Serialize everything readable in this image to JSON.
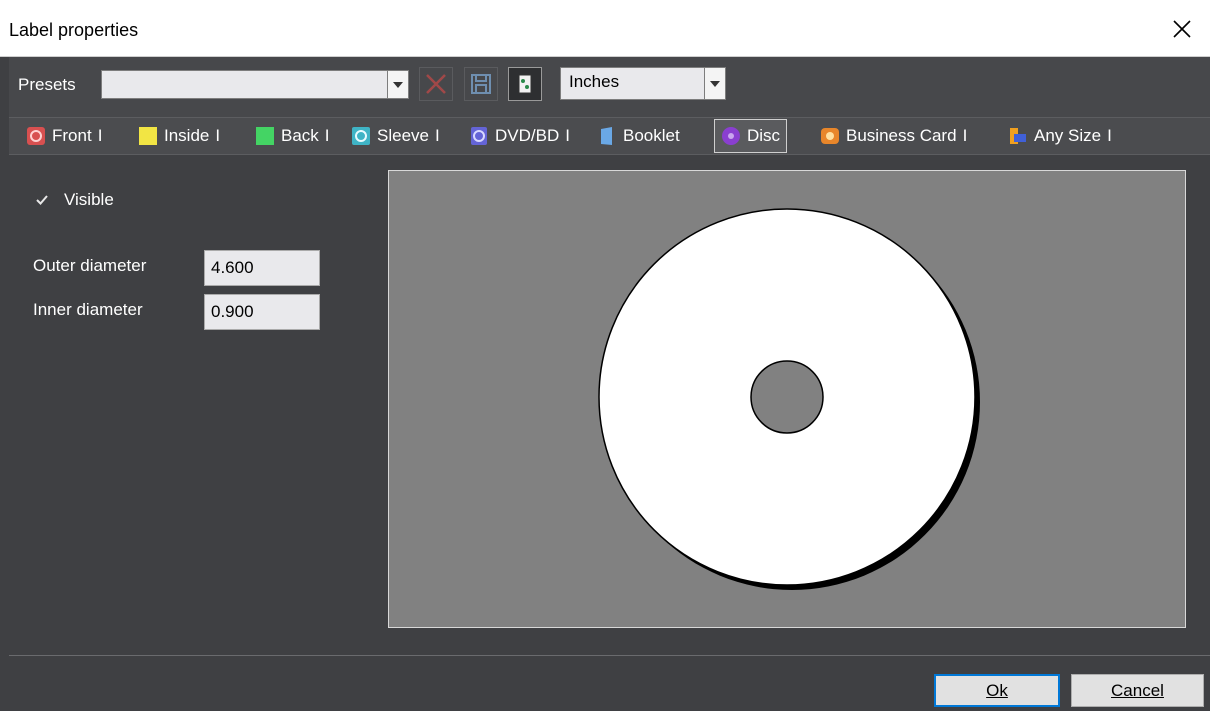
{
  "window": {
    "title": "Label properties"
  },
  "presets": {
    "label": "Presets",
    "value": "",
    "units": "Inches"
  },
  "tabs": [
    {
      "label": "Front",
      "sep": "I",
      "icon": "front-icon",
      "color": "#e05050"
    },
    {
      "label": "Inside",
      "sep": "I",
      "icon": "inside-icon",
      "color": "#f0e040"
    },
    {
      "label": "Back",
      "sep": "I",
      "icon": "back-icon",
      "color": "#40d060"
    },
    {
      "label": "Sleeve",
      "sep": "I",
      "icon": "sleeve-icon",
      "color": "#30b0c0"
    },
    {
      "label": "DVD/BD",
      "sep": "I",
      "icon": "dvd-icon",
      "color": "#6060d0"
    },
    {
      "label": "Booklet",
      "sep": "",
      "icon": "booklet-icon",
      "color": "#60a0e0"
    },
    {
      "label": "Disc",
      "sep": "",
      "icon": "disc-icon",
      "color": "#8040c0",
      "active": true
    },
    {
      "label": "Business Card",
      "sep": "I",
      "icon": "business-card-icon",
      "color": "#e08020"
    },
    {
      "label": "Any Size",
      "sep": "I",
      "icon": "any-size-icon",
      "color": "#4060d0"
    }
  ],
  "disc": {
    "visible_label": "Visible",
    "visible": true,
    "outer_label": "Outer diameter",
    "outer_value": "4.600",
    "inner_label": "Inner diameter",
    "inner_value": "0.900"
  },
  "buttons": {
    "ok": "Ok",
    "cancel": "Cancel"
  }
}
